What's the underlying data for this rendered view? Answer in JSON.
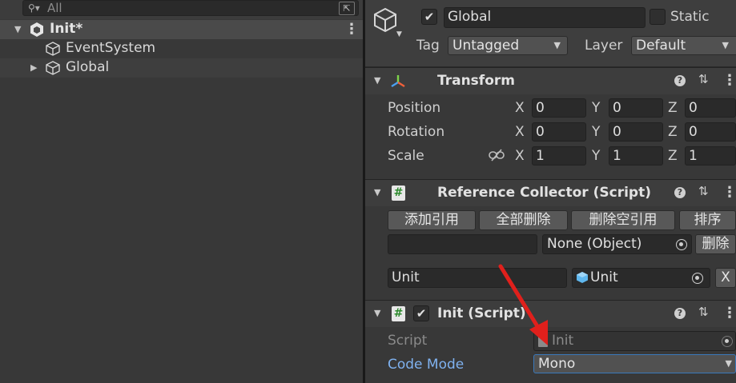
{
  "hierarchy": {
    "search_placeholder": "All",
    "rows": [
      {
        "label": "Init*"
      },
      {
        "label": "EventSystem"
      },
      {
        "label": "Global"
      }
    ]
  },
  "inspector": {
    "object_name": "Global",
    "active_checked": true,
    "static_label": "Static",
    "tag_label": "Tag",
    "tag_value": "Untagged",
    "layer_label": "Layer",
    "layer_value": "Default",
    "transform": {
      "title": "Transform",
      "position_label": "Position",
      "rotation_label": "Rotation",
      "scale_label": "Scale",
      "axis_x": "X",
      "axis_y": "Y",
      "axis_z": "Z",
      "position": {
        "x": "0",
        "y": "0",
        "z": "0"
      },
      "rotation": {
        "x": "0",
        "y": "0",
        "z": "0"
      },
      "scale": {
        "x": "1",
        "y": "1",
        "z": "1"
      }
    },
    "reference_collector": {
      "title": "Reference Collector (Script)",
      "buttons": [
        "添加引用",
        "全部删除",
        "删除空引用",
        "排序"
      ],
      "new_key_value": "",
      "none_object": "None (Object)",
      "delete_label": "删除",
      "entry_key": "Unit",
      "entry_object": "Unit",
      "entry_remove_label": "X"
    },
    "init_script": {
      "title": "Init (Script)",
      "script_label": "Script",
      "script_value": "Init",
      "code_mode_label": "Code Mode",
      "code_mode_value": "Mono"
    }
  },
  "colors": {
    "annotation_arrow": "#e0201c",
    "code_mode_label": "#7fb2f0",
    "selected_field_border": "#3a79bb"
  }
}
